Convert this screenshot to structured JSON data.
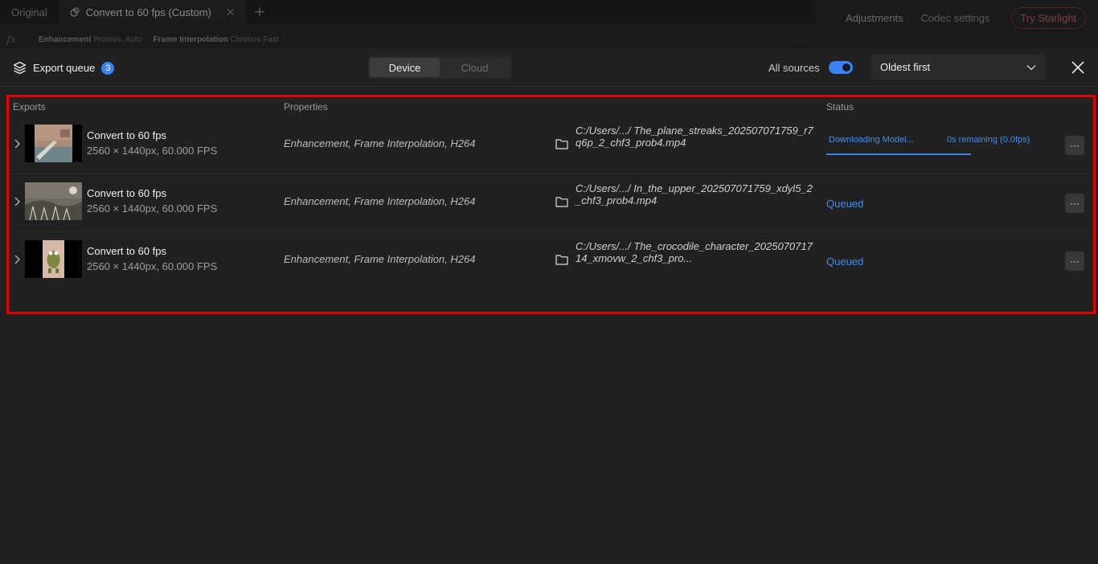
{
  "background": {
    "tabs": [
      {
        "label": "Original"
      },
      {
        "label": "Convert to 60 fps (Custom)"
      }
    ],
    "fx_label": "fx",
    "fx_crumbs": [
      {
        "name": "Enhancement",
        "value": "Proteus, Auto"
      },
      {
        "name": "Frame Interpolation",
        "value": "Chronos Fast"
      }
    ],
    "fx_more": "···",
    "right_tabs": {
      "adjustments": "Adjustments",
      "codec": "Codec settings",
      "starlight": "Try Starlight"
    }
  },
  "header": {
    "title": "Export queue",
    "count": "3",
    "segments": {
      "device": "Device",
      "cloud": "Cloud",
      "selected": "Device"
    },
    "all_sources_label": "All sources",
    "all_sources_on": true,
    "sort": "Oldest first"
  },
  "columns": {
    "exports": "Exports",
    "properties": "Properties",
    "status": "Status"
  },
  "rows": [
    {
      "title": "Convert to 60 fps",
      "meta": "2560 × 1440px, 60.000 FPS",
      "properties": "Enhancement, Frame Interpolation, H264",
      "path": "C:/Users/.../ The_plane_streaks_202507071759_r7q6p_2_chf3_prob4.mp4",
      "status_main": "Downloading Model...",
      "status_remaining": "0s remaining (0.0fps)",
      "progress": 1.0,
      "more": "···"
    },
    {
      "title": "Convert to 60 fps",
      "meta": "2560 × 1440px, 60.000 FPS",
      "properties": "Enhancement, Frame Interpolation, H264",
      "path": "C:/Users/.../ In_the_upper_202507071759_xdyl5_2_chf3_prob4.mp4",
      "status_main": "Queued",
      "more": "···"
    },
    {
      "title": "Convert to 60 fps",
      "meta": "2560 × 1440px, 60.000 FPS",
      "properties": "Enhancement, Frame Interpolation, H264",
      "path": "C:/Users/.../ The_crocodile_character_202507071714_xmovw_2_chf3_pro...",
      "status_main": "Queued",
      "more": "···"
    }
  ],
  "colors": {
    "accent": "#3b82f6",
    "highlight": "#e00000",
    "panel": "#212121"
  }
}
